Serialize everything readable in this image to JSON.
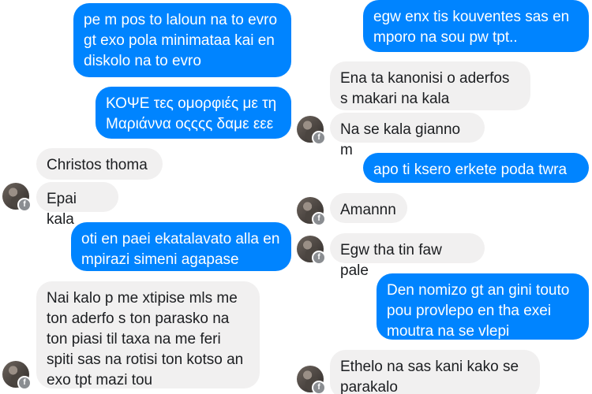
{
  "left_thread": {
    "messages": [
      {
        "direction": "out",
        "text": "pe m pos to laloun na to evro gt exo pola minimataa kai en diskolo na to evro"
      },
      {
        "direction": "out",
        "text": "ΚΟΨΕ τες ομορφιές με τη Μαριάννα οςςςς δαμε εεε"
      },
      {
        "direction": "in",
        "text": "Christos thoma"
      },
      {
        "direction": "in",
        "text": "Epai kala"
      },
      {
        "direction": "out",
        "text": "oti en paei ekatalavato alla en mpirazi simeni agapase"
      },
      {
        "direction": "in",
        "text": "Nai kalo p me xtipise mls me ton aderfo s ton parasko na ton piasi til taxa na me feri spiti sas na rotisi ton kotso an exo tpt mazi tou"
      }
    ]
  },
  "right_thread": {
    "messages": [
      {
        "direction": "out",
        "text": "egw enx tis kouventes sas en mporo na sou pw tpt.."
      },
      {
        "direction": "in",
        "text": "Ena ta kanonisi o aderfos s makari na kala"
      },
      {
        "direction": "in",
        "text": "Na se kala gianno m"
      },
      {
        "direction": "out",
        "text": "apo ti ksero erkete poda twra"
      },
      {
        "direction": "in",
        "text": "Amannn"
      },
      {
        "direction": "in",
        "text": "Egw tha tin faw pale"
      },
      {
        "direction": "out",
        "text": "Den nomizo gt an gini touto pou provlepo en tha exei moutra na se vlepi"
      },
      {
        "direction": "in",
        "text": "Ethelo na sas kani kako se parakalo"
      }
    ]
  },
  "colors": {
    "outgoing": "#0084ff",
    "incoming": "#f1f0f0",
    "incoming_text": "#1c1e21"
  },
  "icons": {
    "avatar_badge": "facebook-icon"
  }
}
